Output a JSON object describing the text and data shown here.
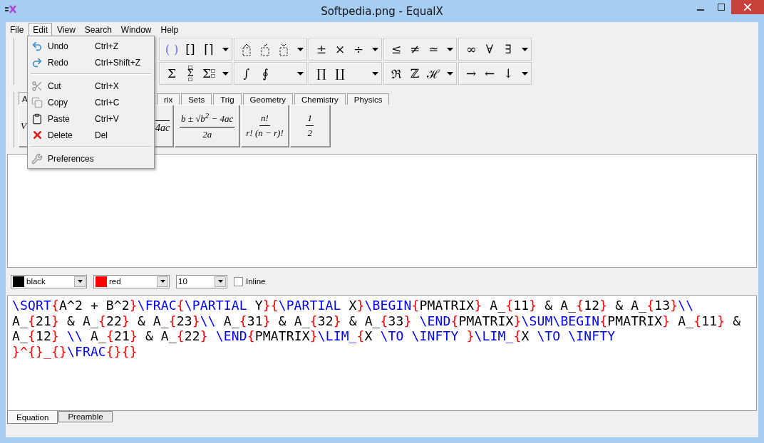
{
  "window": {
    "title": "Softpedia.png - EqualX"
  },
  "menu_bar": [
    {
      "label": "File",
      "selected": false
    },
    {
      "label": "Edit",
      "selected": true
    },
    {
      "label": "View",
      "selected": false
    },
    {
      "label": "Search",
      "selected": false
    },
    {
      "label": "Window",
      "selected": false
    },
    {
      "label": "Help",
      "selected": false
    }
  ],
  "edit_menu": [
    {
      "kind": "undo",
      "label": "Undo",
      "shortcut": "Ctrl+Z",
      "disabled": false
    },
    {
      "kind": "redo",
      "label": "Redo",
      "shortcut": "Ctrl+Shift+Z",
      "disabled": false
    },
    {
      "kind": "separator"
    },
    {
      "kind": "cut",
      "label": "Cut",
      "shortcut": "Ctrl+X",
      "disabled": true
    },
    {
      "kind": "copy",
      "label": "Copy",
      "shortcut": "Ctrl+C",
      "disabled": true
    },
    {
      "kind": "paste",
      "label": "Paste",
      "shortcut": "Ctrl+V",
      "disabled": false
    },
    {
      "kind": "delete",
      "label": "Delete",
      "shortcut": "Del",
      "disabled": false
    },
    {
      "kind": "separator"
    },
    {
      "kind": "preferences",
      "label": "Preferences",
      "disabled": true
    }
  ],
  "toolbar": {
    "rows": [
      [
        {
          "items": [
            {
              "kind": "glyph",
              "text": "( )",
              "color": "#6a6aff"
            },
            {
              "kind": "glyph",
              "text": "[]"
            },
            {
              "kind": "glyph",
              "text": "⌈⌉"
            }
          ]
        },
        {
          "items": [
            {
              "kind": "hat-box"
            },
            {
              "kind": "acute-box"
            },
            {
              "kind": "breve-box"
            }
          ]
        },
        {
          "items": [
            {
              "kind": "glyph",
              "text": "±"
            },
            {
              "kind": "glyph",
              "text": "×"
            },
            {
              "kind": "glyph",
              "text": "÷"
            }
          ]
        },
        {
          "items": [
            {
              "kind": "glyph",
              "text": "≤"
            },
            {
              "kind": "glyph",
              "text": "≠"
            },
            {
              "kind": "glyph",
              "text": "≃"
            }
          ]
        },
        {
          "items": [
            {
              "kind": "glyph",
              "text": "∞"
            },
            {
              "kind": "glyph",
              "text": "∀"
            },
            {
              "kind": "glyph",
              "text": "∃"
            }
          ]
        }
      ],
      [
        {
          "items": [
            {
              "kind": "glyph",
              "text": "Σ"
            },
            {
              "kind": "sum-limits",
              "text": "Σ"
            },
            {
              "kind": "sum-dots",
              "text": "Σ"
            }
          ]
        },
        {
          "items": [
            {
              "kind": "glyph",
              "text": "∫"
            },
            {
              "kind": "glyph",
              "text": "∮"
            }
          ]
        },
        {
          "items": [
            {
              "kind": "glyph",
              "text": "∏"
            },
            {
              "kind": "glyph",
              "text": "∐"
            }
          ]
        },
        {
          "items": [
            {
              "kind": "glyph",
              "text": "ℜ"
            },
            {
              "kind": "glyph",
              "text": "ℤ"
            },
            {
              "kind": "glyph",
              "text": "ℋ"
            }
          ]
        },
        {
          "items": [
            {
              "kind": "glyph",
              "text": "→"
            },
            {
              "kind": "glyph",
              "text": "←"
            },
            {
              "kind": "glyph",
              "text": "↓"
            }
          ]
        }
      ]
    ]
  },
  "template_tabs": [
    {
      "label": "A",
      "selected": true
    },
    {
      "label": "rix",
      "selected": false
    },
    {
      "label": "Sets",
      "selected": false
    },
    {
      "label": "Trig",
      "selected": false
    },
    {
      "label": "Geometry",
      "selected": false
    },
    {
      "label": "Chemistry",
      "selected": false
    },
    {
      "label": "Physics",
      "selected": false
    }
  ],
  "templates": [
    {
      "kind": "text",
      "text": "V"
    },
    {
      "kind": "cut-fraction",
      "text": "4ac"
    },
    {
      "kind": "fraction",
      "numerator": "b ± √b$^{2}$ − 4ac",
      "denominator": "2a"
    },
    {
      "kind": "fraction",
      "numerator": "n!",
      "denominator": "r! (n − r)!"
    },
    {
      "kind": "fraction",
      "numerator": "1",
      "denominator": "2"
    }
  ],
  "format_bar": {
    "foreground": {
      "value": "black",
      "color": "#000000"
    },
    "background": {
      "value": "red",
      "color": "#ff0000"
    },
    "size": "10",
    "inline": {
      "label": "Inline",
      "checked": false
    }
  },
  "editor": {
    "lines": [
      [
        {
          "kind": "command",
          "text": "\\SQRT"
        },
        {
          "kind": "brace",
          "text": "{"
        },
        {
          "kind": "text",
          "text": "A^2 + B^2"
        },
        {
          "kind": "brace",
          "text": "}"
        },
        {
          "kind": "command",
          "text": "\\FRAC"
        },
        {
          "kind": "brace",
          "text": "{"
        },
        {
          "kind": "command",
          "text": "\\PARTIAL"
        },
        {
          "kind": "text",
          "text": " Y"
        },
        {
          "kind": "brace",
          "text": "}{"
        },
        {
          "kind": "command",
          "text": "\\PARTIAL"
        },
        {
          "kind": "text",
          "text": " X"
        },
        {
          "kind": "brace",
          "text": "}"
        },
        {
          "kind": "command",
          "text": "\\BEGIN"
        },
        {
          "kind": "brace",
          "text": "{"
        },
        {
          "kind": "text",
          "text": "PMATRIX"
        },
        {
          "kind": "brace",
          "text": "}"
        },
        {
          "kind": "text",
          "text": " A_"
        },
        {
          "kind": "brace",
          "text": "{"
        },
        {
          "kind": "text",
          "text": "11"
        },
        {
          "kind": "brace",
          "text": "}"
        },
        {
          "kind": "text",
          "text": " & A_"
        },
        {
          "kind": "brace",
          "text": "{"
        },
        {
          "kind": "text",
          "text": "12"
        },
        {
          "kind": "brace",
          "text": "}"
        },
        {
          "kind": "text",
          "text": " & A_"
        },
        {
          "kind": "brace",
          "text": "{"
        },
        {
          "kind": "text",
          "text": "13"
        },
        {
          "kind": "brace",
          "text": "}"
        },
        {
          "kind": "command",
          "text": "\\\\"
        }
      ],
      [
        {
          "kind": "text",
          "text": "A_"
        },
        {
          "kind": "brace",
          "text": "{"
        },
        {
          "kind": "text",
          "text": "21"
        },
        {
          "kind": "brace",
          "text": "}"
        },
        {
          "kind": "text",
          "text": " & A_"
        },
        {
          "kind": "brace",
          "text": "{"
        },
        {
          "kind": "text",
          "text": "22"
        },
        {
          "kind": "brace",
          "text": "}"
        },
        {
          "kind": "text",
          "text": " & A_"
        },
        {
          "kind": "brace",
          "text": "{"
        },
        {
          "kind": "text",
          "text": "23"
        },
        {
          "kind": "brace",
          "text": "}"
        },
        {
          "kind": "command",
          "text": "\\\\"
        },
        {
          "kind": "text",
          "text": " A_"
        },
        {
          "kind": "brace",
          "text": "{"
        },
        {
          "kind": "text",
          "text": "31"
        },
        {
          "kind": "brace",
          "text": "}"
        },
        {
          "kind": "text",
          "text": " & A_"
        },
        {
          "kind": "brace",
          "text": "{"
        },
        {
          "kind": "text",
          "text": "32"
        },
        {
          "kind": "brace",
          "text": "}"
        },
        {
          "kind": "text",
          "text": " & A_"
        },
        {
          "kind": "brace",
          "text": "{"
        },
        {
          "kind": "text",
          "text": "33"
        },
        {
          "kind": "brace",
          "text": "}"
        },
        {
          "kind": "command",
          "text": " \\END"
        },
        {
          "kind": "brace",
          "text": "{"
        },
        {
          "kind": "text",
          "text": "PMATRIX"
        },
        {
          "kind": "brace",
          "text": "}"
        },
        {
          "kind": "command",
          "text": "\\SUM\\BEGIN"
        },
        {
          "kind": "brace",
          "text": "{"
        },
        {
          "kind": "text",
          "text": "PMATRIX"
        },
        {
          "kind": "brace",
          "text": "}"
        },
        {
          "kind": "text",
          "text": " A_"
        },
        {
          "kind": "brace",
          "text": "{"
        },
        {
          "kind": "text",
          "text": "11"
        },
        {
          "kind": "brace",
          "text": "}"
        },
        {
          "kind": "text",
          "text": " &"
        }
      ],
      [
        {
          "kind": "text",
          "text": "A_"
        },
        {
          "kind": "brace",
          "text": "{"
        },
        {
          "kind": "text",
          "text": "12"
        },
        {
          "kind": "brace",
          "text": "}"
        },
        {
          "kind": "command",
          "text": " \\\\"
        },
        {
          "kind": "text",
          "text": " A_"
        },
        {
          "kind": "brace",
          "text": "{"
        },
        {
          "kind": "text",
          "text": "21"
        },
        {
          "kind": "brace",
          "text": "}"
        },
        {
          "kind": "text",
          "text": " & A_"
        },
        {
          "kind": "brace",
          "text": "{"
        },
        {
          "kind": "text",
          "text": "22"
        },
        {
          "kind": "brace",
          "text": "}"
        },
        {
          "kind": "command",
          "text": " \\END"
        },
        {
          "kind": "brace",
          "text": "{"
        },
        {
          "kind": "text",
          "text": "PMATRIX"
        },
        {
          "kind": "brace",
          "text": "}"
        },
        {
          "kind": "command",
          "text": "\\LIM_"
        },
        {
          "kind": "brace",
          "text": "{"
        },
        {
          "kind": "text",
          "text": "X "
        },
        {
          "kind": "command",
          "text": "\\TO \\INFTY "
        },
        {
          "kind": "brace",
          "text": "}"
        },
        {
          "kind": "command",
          "text": "\\LIM_"
        },
        {
          "kind": "brace",
          "text": "{"
        },
        {
          "kind": "text",
          "text": "X "
        },
        {
          "kind": "command",
          "text": "\\TO \\INFTY"
        }
      ],
      [
        {
          "kind": "brace",
          "text": "}^{}_{}"
        },
        {
          "kind": "command",
          "text": "\\FRAC"
        },
        {
          "kind": "brace",
          "text": "{}{}"
        }
      ]
    ]
  },
  "bottom_tabs": [
    {
      "label": "Equation",
      "selected": true
    },
    {
      "label": "Preamble",
      "selected": false
    }
  ]
}
